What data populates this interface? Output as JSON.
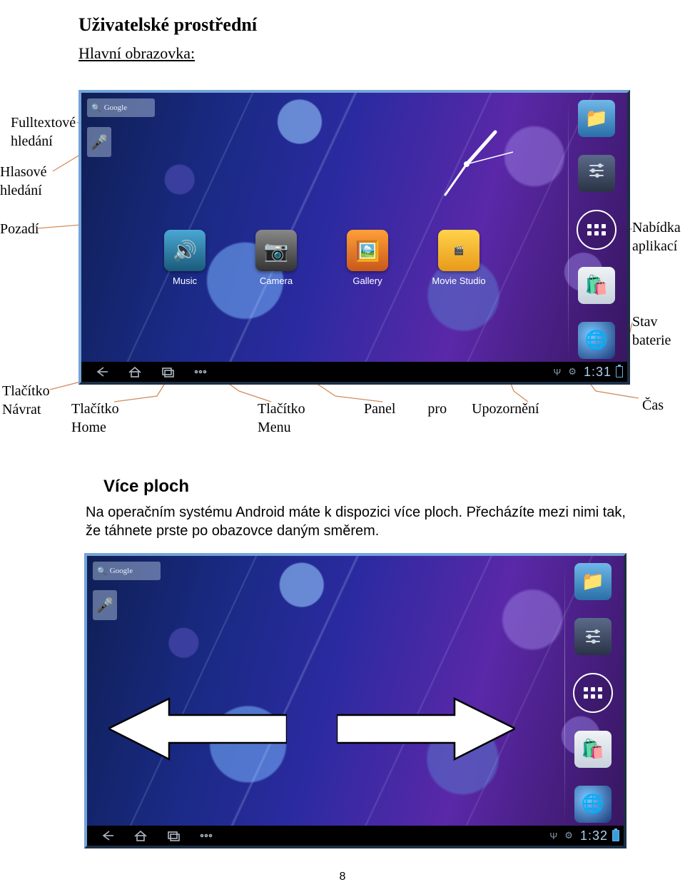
{
  "title": "Uživatelské prostřední",
  "subtitle": "Hlavní obrazovka:",
  "callouts": {
    "fulltext_1": "Fulltextové",
    "fulltext_2": "hledání",
    "hlasove_1": "Hlasové",
    "hlasove_2": "hledání",
    "pozadi": "Pozadí",
    "nabidka_1": "Nabídka",
    "nabidka_2": "aplikací",
    "stav_1": "Stav",
    "stav_2": "baterie",
    "navrat_1": "Tlačítko",
    "navrat_2": "Návrat",
    "home_1": "Tlačítko",
    "home_2": "Home",
    "menu_1": "Tlačítko",
    "menu_2": "Menu",
    "panel": "Panel         pro       Upozornění",
    "cas": "Čas"
  },
  "screenshot": {
    "search_label": "Google",
    "apps": {
      "music": "Music",
      "camera": "Camera",
      "gallery": "Gallery",
      "movie": "Movie Studio"
    },
    "clock_1": "1:31",
    "clock_2": "1:32"
  },
  "section_heading": "Více ploch",
  "section_body": "Na operačním systému Android máte k dispozici více ploch. Přecházíte mezi nimi tak, že táhnete prste po obazovce daným směrem.",
  "page_number": "8"
}
